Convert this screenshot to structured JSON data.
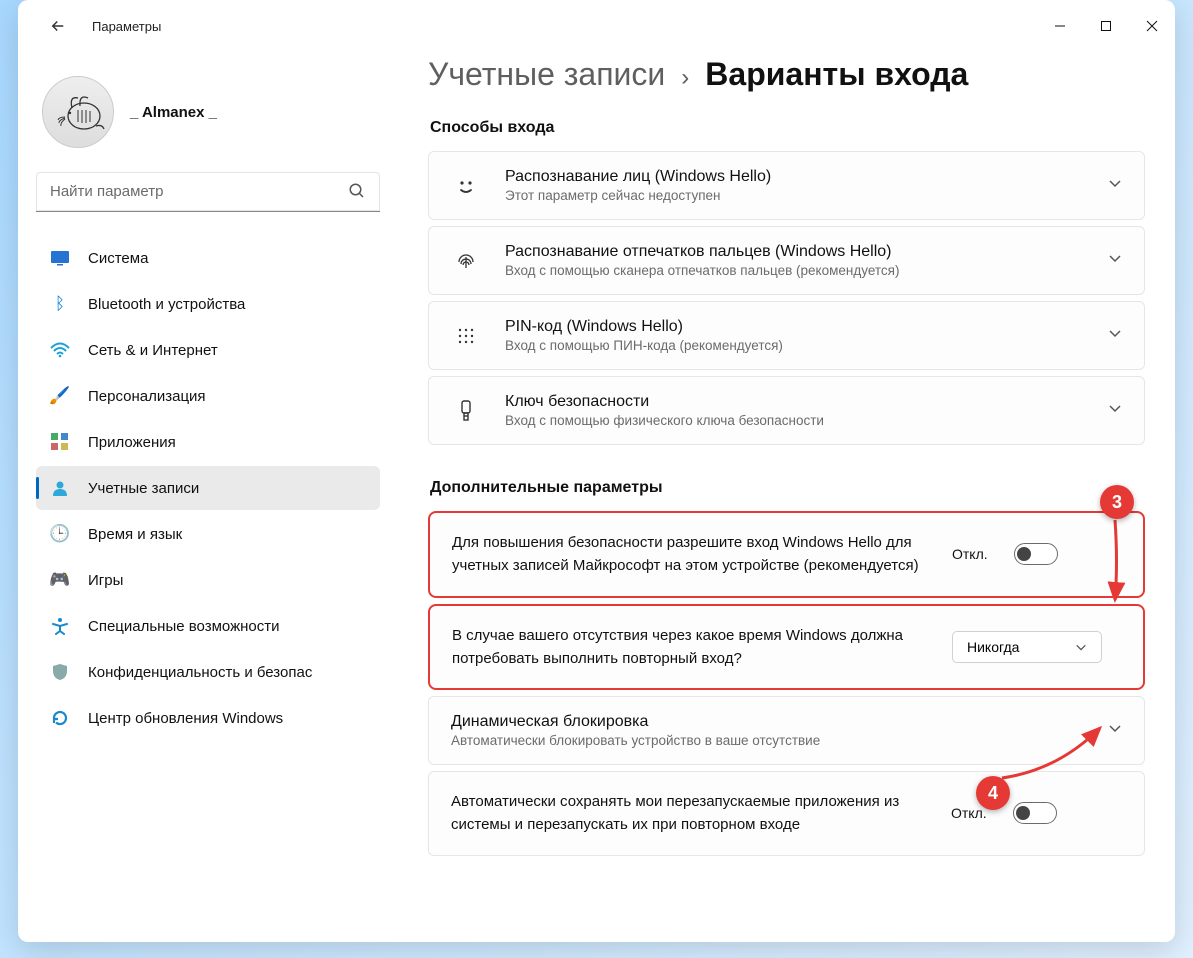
{
  "app_title": "Параметры",
  "user": {
    "name": "_ Almanex _"
  },
  "search_placeholder": "Найти параметр",
  "breadcrumb": {
    "parent": "Учетные записи",
    "sep": "›",
    "current": "Варианты входа"
  },
  "nav": [
    {
      "icon": "monitor",
      "label": "Система"
    },
    {
      "icon": "bluetooth",
      "label": "Bluetooth и устройства"
    },
    {
      "icon": "wifi",
      "label": "Сеть & и Интернет"
    },
    {
      "icon": "brush",
      "label": "Персонализация"
    },
    {
      "icon": "apps",
      "label": "Приложения"
    },
    {
      "icon": "person",
      "label": "Учетные записи"
    },
    {
      "icon": "clock",
      "label": "Время и язык"
    },
    {
      "icon": "game",
      "label": "Игры"
    },
    {
      "icon": "accessibility",
      "label": "Специальные возможности"
    },
    {
      "icon": "shield",
      "label": "Конфиденциальность и безопас"
    },
    {
      "icon": "update",
      "label": "Центр обновления Windows"
    }
  ],
  "section1_title": "Способы входа",
  "signin_methods": [
    {
      "icon": "face",
      "title": "Распознавание лиц (Windows Hello)",
      "sub": "Этот параметр сейчас недоступен"
    },
    {
      "icon": "fingerprint",
      "title": "Распознавание отпечатков пальцев (Windows Hello)",
      "sub": "Вход с помощью сканера отпечатков пальцев (рекомендуется)"
    },
    {
      "icon": "pin",
      "title": "PIN-код (Windows Hello)",
      "sub": "Вход с помощью ПИН-кода (рекомендуется)"
    },
    {
      "icon": "key",
      "title": "Ключ безопасности",
      "sub": "Вход с помощью физического ключа безопасности"
    }
  ],
  "section2_title": "Дополнительные параметры",
  "additional": {
    "hello_only": {
      "text": "Для повышения безопасности разрешите вход Windows Hello для учетных записей Майкрософт на этом устройстве (рекомендуется)",
      "state_label": "Откл."
    },
    "require_signin": {
      "text": "В случае вашего отсутствия через какое время Windows должна потребовать выполнить повторный вход?",
      "value": "Никогда"
    },
    "dynamic_lock": {
      "title": "Динамическая блокировка",
      "sub": "Автоматически блокировать устройство в ваше отсутствие"
    },
    "restart_apps": {
      "text": "Автоматически сохранять мои перезапускаемые приложения из системы и перезапускать их при повторном входе",
      "state_label": "Откл."
    }
  },
  "annotations": {
    "badge3": "3",
    "badge4": "4"
  },
  "colors": {
    "accent": "#0067c0",
    "annotation": "#e53935"
  }
}
